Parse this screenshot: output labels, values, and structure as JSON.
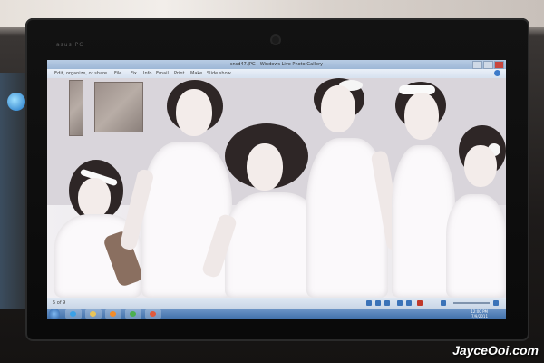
{
  "window": {
    "title": "snsd47.JPG - Windows Live Photo Gallery",
    "controls": [
      "minimize-icon",
      "maximize-icon",
      "close-icon"
    ]
  },
  "menubar": {
    "items": [
      "Edit, organize, or share",
      "File",
      "Fix",
      "Info",
      "Email",
      "Print",
      "Make",
      "Slide show"
    ]
  },
  "statusbar": {
    "page": "5 of 9"
  },
  "taskbar": {
    "time": "12:00 PM",
    "date": "7/9/2011"
  },
  "device": {
    "brand": "asus PC"
  },
  "watermark": "JayceOoi.com",
  "colors": {
    "bezel": "#121212",
    "titlebar": "#b8cce4",
    "taskbar": "#3f6ea8",
    "photo": "#ecebef"
  }
}
